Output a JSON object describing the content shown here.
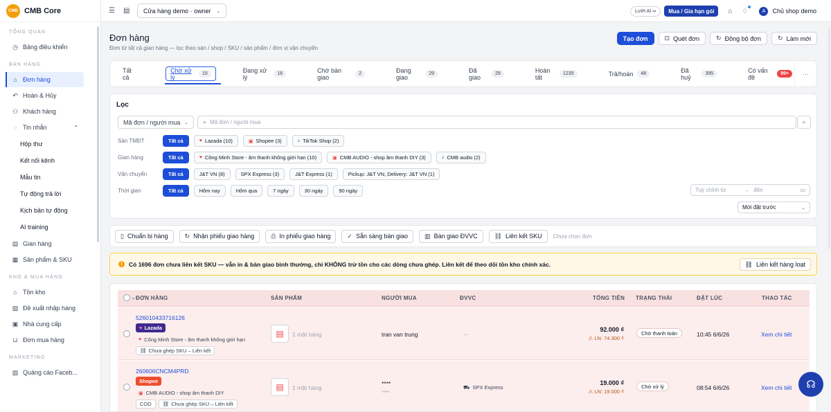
{
  "brand": {
    "logo_text": "CMB",
    "name": "CMB Core"
  },
  "sidebar": {
    "sections": [
      {
        "title": "TỔNG QUAN",
        "items": [
          {
            "label": "Bảng điều khiển",
            "icon": "dashboard-icon"
          }
        ]
      },
      {
        "title": "BÁN HÀNG",
        "items": [
          {
            "label": "Đơn hàng",
            "icon": "bag-icon",
            "active": true
          },
          {
            "label": "Hoàn & Hủy",
            "icon": "return-icon"
          },
          {
            "label": "Khách hàng",
            "icon": "users-icon"
          },
          {
            "label": "Tin nhắn",
            "icon": "chat-icon",
            "expanded": true
          },
          {
            "label": "Hộp thư",
            "sub": true
          },
          {
            "label": "Kết nối kênh",
            "sub": true
          },
          {
            "label": "Mẫu tin",
            "sub": true
          },
          {
            "label": "Tự động trả lời",
            "sub": true
          },
          {
            "label": "Kịch bản tự động",
            "sub": true
          },
          {
            "label": "AI training",
            "sub": true
          },
          {
            "label": "Gian hàng",
            "icon": "store-icon"
          },
          {
            "label": "Sản phẩm & SKU",
            "icon": "grid-icon"
          }
        ]
      },
      {
        "title": "KHO & MUA HÀNG",
        "items": [
          {
            "label": "Tồn kho",
            "icon": "warehouse-icon"
          },
          {
            "label": "Đề xuất nhập hàng",
            "icon": "chart-icon"
          },
          {
            "label": "Nhà cung cấp",
            "icon": "supplier-icon"
          },
          {
            "label": "Đơn mua hàng",
            "icon": "cart-icon"
          }
        ]
      },
      {
        "title": "MARKETING",
        "items": [
          {
            "label": "Quảng cáo Faceb...",
            "icon": "ads-icon"
          }
        ]
      }
    ]
  },
  "topbar": {
    "store_selector": "Cửa hàng demo · owner",
    "ai_pill": "Lướt AI ∞",
    "buy_button": "Mua / Gia hạn gói",
    "user_name": "Chủ shop demo",
    "user_initial": "A"
  },
  "page": {
    "title": "Đơn hàng",
    "subtitle": "Đơn từ tất cả gian hàng — lọc theo sàn / shop / SKU / sản phẩm / đơn vị vận chuyển",
    "actions": {
      "create": "Tạo đơn",
      "scan": "Quét đơn",
      "sync": "Đồng bộ đơn",
      "refresh": "Làm mới"
    }
  },
  "tabs": [
    {
      "label": "Tất cả",
      "count": ""
    },
    {
      "label": "Chờ xử lý",
      "count": "15",
      "active": true
    },
    {
      "label": "Đang xử lý",
      "count": "16"
    },
    {
      "label": "Chờ bàn giao",
      "count": "2"
    },
    {
      "label": "Đang giao",
      "count": "29"
    },
    {
      "label": "Đã giao",
      "count": "29"
    },
    {
      "label": "Hoàn tất",
      "count": "1235"
    },
    {
      "label": "Trả/hoàn",
      "count": "48"
    },
    {
      "label": "Đã huỷ",
      "count": "395"
    },
    {
      "label": "Có vấn đề",
      "count": "99+",
      "alert": true
    }
  ],
  "filter": {
    "title": "Lọc",
    "search_field": "Mã đơn / người mua",
    "search_placeholder": "Mã đơn / người mua",
    "rows": {
      "platform": {
        "label": "Sàn TMĐT",
        "chips": [
          "Tất cả",
          "Lazada (10)",
          "Shopee (3)",
          "TikTok Shop (2)"
        ]
      },
      "store": {
        "label": "Gian hàng",
        "chips": [
          "Tất cả",
          "Công Minh Store - âm thanh không giới hạn (10)",
          "CMB AUDIO - shop âm thanh DIY (3)",
          "CMB audio (2)"
        ]
      },
      "shipping": {
        "label": "Vận chuyển",
        "chips": [
          "Tất cả",
          "J&T VN (8)",
          "SPX Express (3)",
          "J&T Express (1)",
          "Pickup: J&T VN, Delivery: J&T VN (1)"
        ]
      },
      "time": {
        "label": "Thời gian",
        "chips": [
          "Tất cả",
          "Hôm nay",
          "Hôm qua",
          "7 ngày",
          "30 ngày",
          "90 ngày"
        ]
      }
    },
    "date_from": "Tuỳ chỉnh từ",
    "date_to": "đến",
    "sort": "Mới đặt trước"
  },
  "bulk": {
    "prepare": "Chuẩn bị hàng",
    "receive": "Nhận phiếu giao hàng",
    "print": "In phiếu giao hàng",
    "ready": "Sẵn sàng bàn giao",
    "handover": "Bàn giao ĐVVC",
    "link_sku": "Liên kết SKU",
    "hint": "Chưa chọn đơn"
  },
  "warning": {
    "text": "Có 1696 đơn chưa liên kết SKU — vẫn in & bàn giao bình thường, chỉ KHÔNG trừ tồn cho các dòng chưa ghép. Liên kết để theo dõi tồn kho chính xác.",
    "button": "Liên kết hàng loạt"
  },
  "table": {
    "headers": {
      "order": "ĐƠN HÀNG",
      "product": "SẢN PHẨM",
      "buyer": "NGƯỜI MUA",
      "carrier": "ĐVVC",
      "total": "TỔNG TIỀN",
      "status": "TRẠNG THÁI",
      "date": "ĐẶT LÚC",
      "action": "THAO TÁC"
    },
    "rows": [
      {
        "id": "526010433716126",
        "platform": "Lazada",
        "shop": "Công Minh Store - âm thanh không giới hạn",
        "tags": [
          "Chưa ghép SKU – Liên kết"
        ],
        "products": "1 mặt hàng",
        "buyer": "tran van trung",
        "buyer2": "",
        "carrier": "—",
        "total": "92.000 ₫",
        "ln": "LN: 74.300 ₫",
        "status": "Chờ thanh toán",
        "date": "10:45 6/6/26",
        "action": "Xem chi tiết"
      },
      {
        "id": "260606CNCM4PRD",
        "platform": "Shopee",
        "shop": "CMB AUDIO - shop âm thanh DIY",
        "tags": [
          "COD",
          "Chưa ghép SKU – Liên kết"
        ],
        "products": "1 mặt hàng",
        "buyer": "****",
        "buyer2": "****",
        "carrier": "SPX Express",
        "total": "19.000 ₫",
        "ln": "LN: 19.000 ₫",
        "status": "Chờ xử lý",
        "date": "08:54 6/6/26",
        "action": "Xem chi tiết"
      }
    ]
  }
}
